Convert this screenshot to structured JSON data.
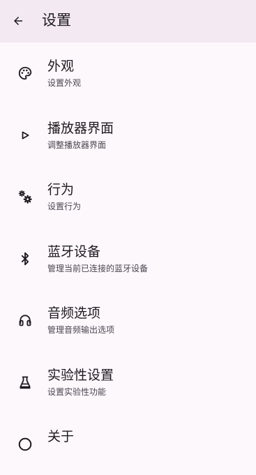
{
  "header": {
    "title": "设置",
    "back_icon": "arrow-back-icon"
  },
  "items": [
    {
      "label": "外观",
      "desc": "设置外观",
      "icon": "palette-icon"
    },
    {
      "label": "播放器界面",
      "desc": "调整播放器界面",
      "icon": "play-icon"
    },
    {
      "label": "行为",
      "desc": "设置行为",
      "icon": "gears-icon"
    },
    {
      "label": "蓝牙设备",
      "desc": "管理当前已连接的蓝牙设备",
      "icon": "bluetooth-icon"
    },
    {
      "label": "音频选项",
      "desc": "管理音频输出选项",
      "icon": "headphones-icon"
    },
    {
      "label": "实验性设置",
      "desc": "设置实验性功能",
      "icon": "flask-icon"
    },
    {
      "label": "关于",
      "desc": "",
      "icon": "info-icon"
    }
  ],
  "colors": {
    "topbar": "#f3e9f3",
    "background": "#fdf8fc",
    "text": "#1c1b1f",
    "subtext": "#49454f"
  }
}
